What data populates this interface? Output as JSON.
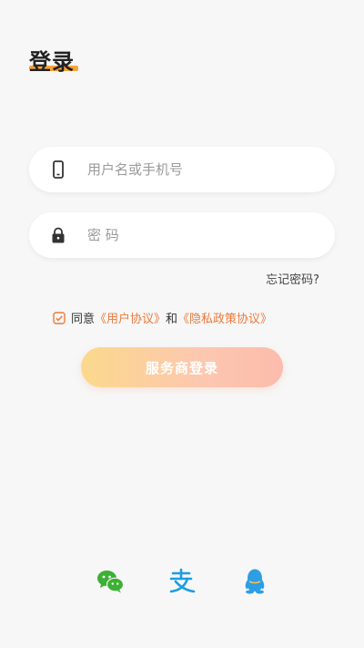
{
  "header": {
    "title": "登录"
  },
  "form": {
    "username_placeholder": "用户名或手机号",
    "password_placeholder": "密 码",
    "forgot_label": "忘记密码?"
  },
  "agreement": {
    "prefix": "同意",
    "user_agreement": "《用户协议》",
    "conjunction": "和",
    "privacy_policy": "《隐私政策协议》",
    "checked": true
  },
  "login_button": {
    "label": "服务商登录"
  },
  "social": [
    {
      "icon": "wechat-icon",
      "color": "#3cb034"
    },
    {
      "icon": "alipay-icon",
      "color": "#1c9ee4"
    },
    {
      "icon": "qq-icon",
      "color": "#2f9de4"
    }
  ],
  "colors": {
    "accent": "#ec7a3a",
    "title_underline": "#f5a33a"
  }
}
